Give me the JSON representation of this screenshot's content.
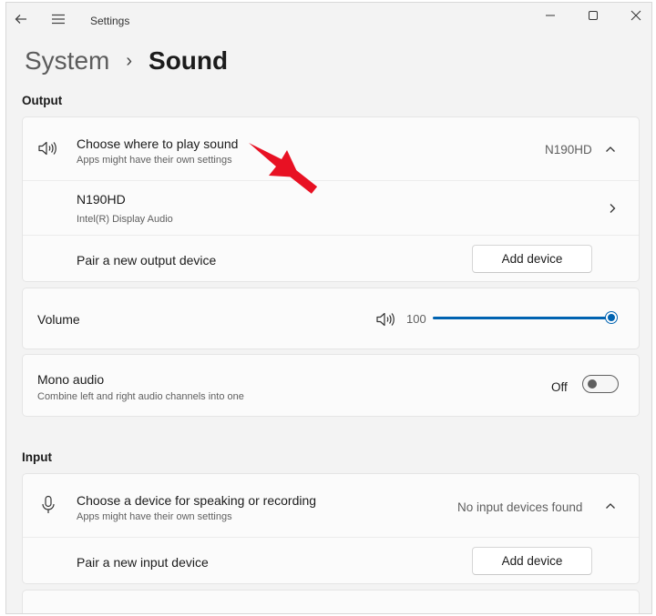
{
  "window": {
    "title": "Settings"
  },
  "breadcrumb": {
    "parent": "System",
    "separator": "›",
    "current": "Sound"
  },
  "output": {
    "heading": "Output",
    "choose_row": {
      "title": "Choose where to play sound",
      "subtitle": "Apps might have their own settings",
      "selected_device": "N190HD"
    },
    "device": {
      "name": "N190HD",
      "description": "Intel(R) Display Audio"
    },
    "pair": {
      "label": "Pair a new output device",
      "button": "Add device"
    },
    "volume": {
      "label": "Volume",
      "value": "100",
      "level_percent": 100
    },
    "mono": {
      "title": "Mono audio",
      "subtitle": "Combine left and right audio channels into one",
      "state": "Off"
    }
  },
  "input": {
    "heading": "Input",
    "choose_row": {
      "title": "Choose a device for speaking or recording",
      "subtitle": "Apps might have their own settings",
      "status": "No input devices found"
    },
    "pair": {
      "label": "Pair a new input device",
      "button": "Add device"
    }
  },
  "icons": {
    "back": "back-arrow-icon",
    "menu": "hamburger-menu-icon",
    "speaker": "speaker-icon",
    "microphone": "microphone-icon",
    "chevron_up": "chevron-up-icon",
    "chevron_right": "chevron-right-icon"
  },
  "colors": {
    "accent": "#0063b1",
    "annotation_arrow": "#e81123",
    "window_bg": "#f3f3f3",
    "card_bg": "#fbfbfb"
  }
}
